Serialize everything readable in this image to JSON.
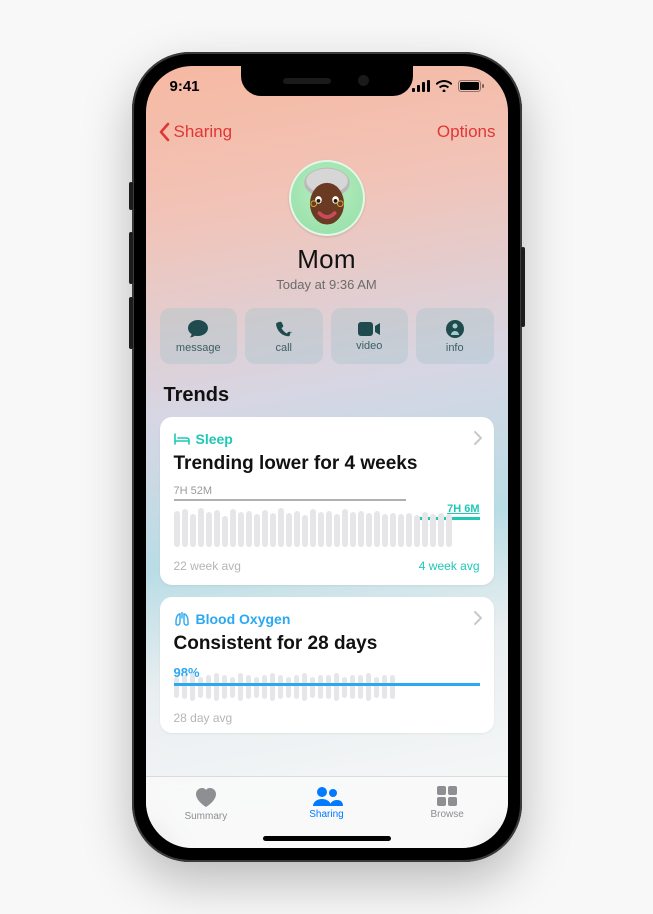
{
  "status": {
    "time": "9:41"
  },
  "nav": {
    "back": "Sharing",
    "options": "Options"
  },
  "contact": {
    "name": "Mom",
    "subtitle": "Today at 9:36 AM"
  },
  "actions": {
    "message": "message",
    "call": "call",
    "video": "video",
    "info": "info"
  },
  "section_title": "Trends",
  "cards": {
    "sleep": {
      "metric": "Sleep",
      "headline": "Trending lower for 4 weeks",
      "value_long": "7H 52M",
      "value_short": "7H 6M",
      "avg_long": "22 week avg",
      "avg_short": "4 week avg"
    },
    "blood": {
      "metric": "Blood Oxygen",
      "headline": "Consistent for 28 days",
      "value": "98%",
      "avg": "28 day avg"
    }
  },
  "tabs": {
    "summary": "Summary",
    "sharing": "Sharing",
    "browse": "Browse"
  },
  "chart_data": [
    {
      "type": "bar",
      "title": "Sleep",
      "series": [
        {
          "name": "daily",
          "values": [
            7.5,
            7.9,
            6.8,
            8.1,
            7.2,
            7.7,
            6.5,
            8.0,
            7.3,
            7.6,
            6.9,
            7.8,
            7.1,
            8.2,
            7.0,
            7.4,
            6.7,
            7.9,
            7.2,
            7.5,
            6.8,
            8.0,
            7.3,
            7.6,
            7.0,
            7.4,
            6.9,
            7.1,
            6.8,
            7.0,
            6.7,
            7.2,
            6.9,
            7.1,
            6.8
          ]
        }
      ],
      "annotations": {
        "long_avg_hours": 7.87,
        "short_avg_hours": 7.1
      },
      "ylim": [
        0,
        10
      ]
    },
    {
      "type": "bar",
      "title": "Blood Oxygen",
      "series": [
        {
          "name": "daily_pct",
          "values": [
            97,
            98,
            99,
            97,
            98,
            99,
            98,
            97,
            99,
            98,
            97,
            98,
            99,
            98,
            97,
            98,
            99,
            97,
            98,
            98,
            99,
            97,
            98,
            98,
            99,
            97,
            98,
            98
          ]
        }
      ],
      "annotations": {
        "avg_pct": 98
      },
      "ylim": [
        90,
        100
      ]
    }
  ]
}
